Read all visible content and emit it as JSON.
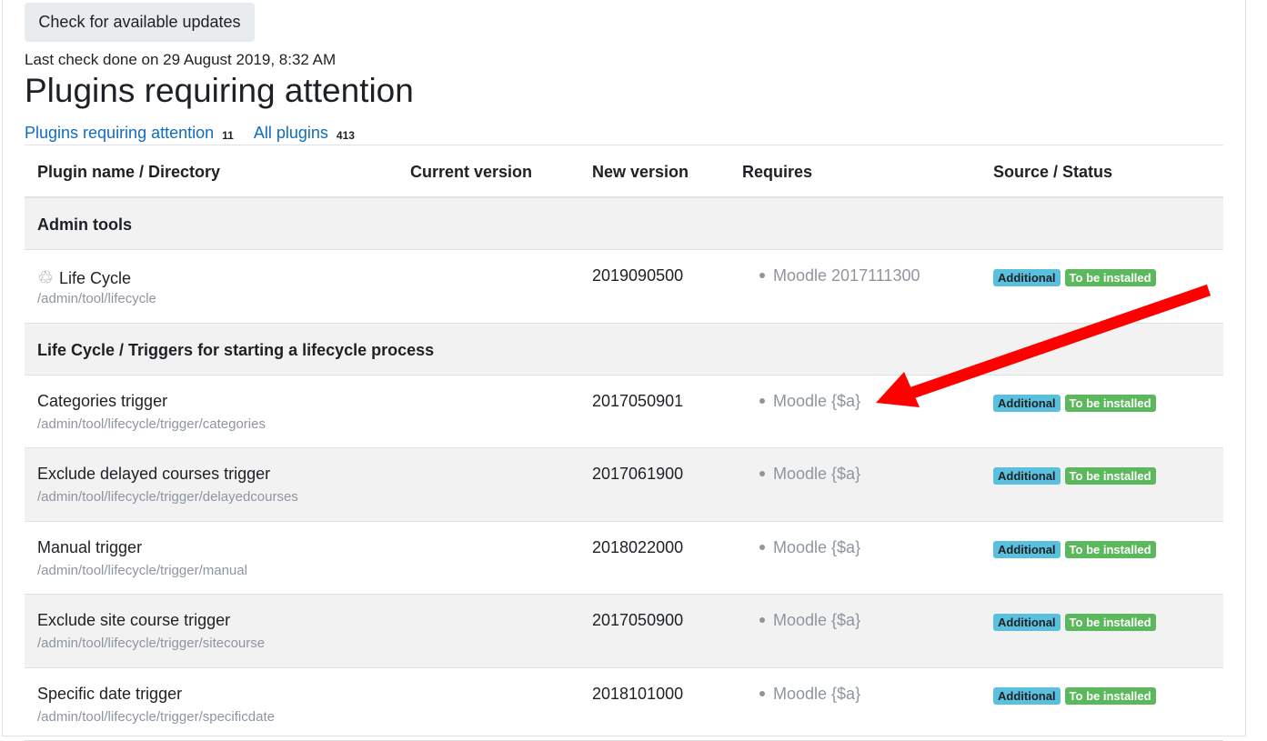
{
  "header": {
    "check_button": "Check for available updates",
    "last_check": "Last check done on 29 August 2019, 8:32 AM",
    "title": "Plugins requiring attention"
  },
  "filters": [
    {
      "label": "Plugins requiring attention",
      "count": "11"
    },
    {
      "label": "All plugins",
      "count": "413"
    }
  ],
  "columns": [
    "Plugin name / Directory",
    "Current version",
    "New version",
    "Requires",
    "Source / Status"
  ],
  "groups": [
    {
      "label": "Admin tools",
      "plugins": [
        {
          "name": "Life Cycle",
          "dir": "/admin/tool/lifecycle",
          "new_version": "2019090500",
          "requires": "Moodle 2017111300",
          "source": "Additional",
          "status": "To be installed"
        }
      ]
    },
    {
      "label": "Life Cycle / Triggers for starting a lifecycle process",
      "plugins": [
        {
          "name": "Categories trigger",
          "dir": "/admin/tool/lifecycle/trigger/categories",
          "new_version": "2017050901",
          "requires": "Moodle {$a}",
          "source": "Additional",
          "status": "To be installed"
        },
        {
          "name": "Exclude delayed courses trigger",
          "dir": "/admin/tool/lifecycle/trigger/delayedcourses",
          "new_version": "2017061900",
          "requires": "Moodle {$a}",
          "source": "Additional",
          "status": "To be installed"
        },
        {
          "name": "Manual trigger",
          "dir": "/admin/tool/lifecycle/trigger/manual",
          "new_version": "2018022000",
          "requires": "Moodle {$a}",
          "source": "Additional",
          "status": "To be installed"
        },
        {
          "name": "Exclude site course trigger",
          "dir": "/admin/tool/lifecycle/trigger/sitecourse",
          "new_version": "2017050900",
          "requires": "Moodle {$a}",
          "source": "Additional",
          "status": "To be installed"
        },
        {
          "name": "Specific date trigger",
          "dir": "/admin/tool/lifecycle/trigger/specificdate",
          "new_version": "2018101000",
          "requires": "Moodle {$a}",
          "source": "Additional",
          "status": "To be installed"
        }
      ]
    }
  ],
  "colors": {
    "link": "#0f6cbf",
    "badge_info": "#5bc0de",
    "badge_success": "#5cb85c",
    "annotation_arrow": "#ff0000"
  },
  "icons": {
    "plugin_icon": "recycle-icon"
  }
}
